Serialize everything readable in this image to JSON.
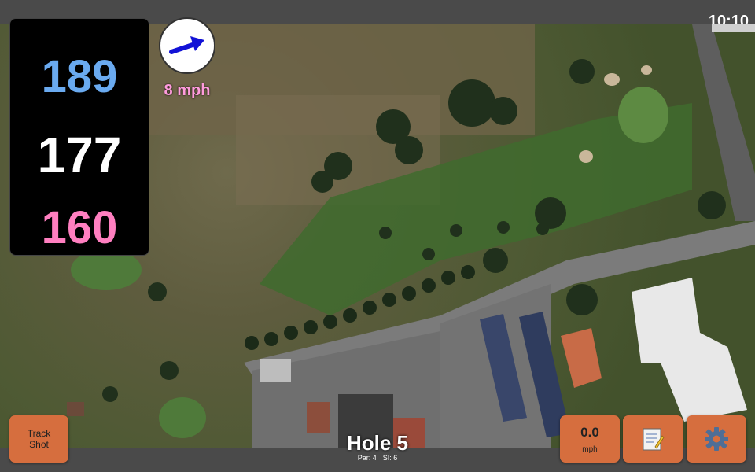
{
  "status_bar": {
    "time": "10:10"
  },
  "distances": {
    "back": "189",
    "middle": "177",
    "front": "160"
  },
  "wind": {
    "speed_label": "8 mph",
    "direction": "arrow-right-up-icon"
  },
  "buttons": {
    "track_shot_line1": "Track",
    "track_shot_line2": "Shot",
    "speed_value": "0.0",
    "speed_unit": "mph",
    "notes_icon": "notepad-icon",
    "settings_icon": "gear-icon"
  },
  "hole": {
    "title": "Hole 5",
    "par": "Par: 4",
    "si": "SI: 6"
  },
  "colors": {
    "back": "#6aaaf0",
    "middle": "#ffffff",
    "front": "#ff7fc0",
    "button": "#d66e3e",
    "wind_label": "#ff9bdc"
  }
}
